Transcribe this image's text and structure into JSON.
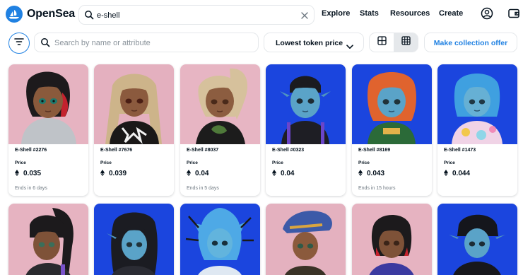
{
  "brand": {
    "name": "OpenSea"
  },
  "search": {
    "value": "e-shell"
  },
  "nav": [
    "Explore",
    "Stats",
    "Resources",
    "Create"
  ],
  "toolbar": {
    "attribute_placeholder": "Search by name or attribute",
    "sort_label": "Lowest token price",
    "offer_label": "Make collection offer"
  },
  "colors": {
    "accent": "#2081e2",
    "pink_bg": "#e8b4c4",
    "blue_bg": "#1a47e0"
  },
  "items": [
    {
      "name": "E-Shell #2276",
      "price_label": "Price",
      "price": "0.035",
      "ends": "Ends in 6 days"
    },
    {
      "name": "E-Shell #7676",
      "price_label": "Price",
      "price": "0.039",
      "ends": ""
    },
    {
      "name": "E-Shell #8037",
      "price_label": "Price",
      "price": "0.04",
      "ends": "Ends in 5 days"
    },
    {
      "name": "E-Shell #0323",
      "price_label": "Price",
      "price": "0.04",
      "ends": ""
    },
    {
      "name": "E-Shell #8169",
      "price_label": "Price",
      "price": "0.043",
      "ends": "Ends in 15 hours"
    },
    {
      "name": "E-Shell #1473",
      "price_label": "Price",
      "price": "0.044",
      "ends": ""
    }
  ]
}
